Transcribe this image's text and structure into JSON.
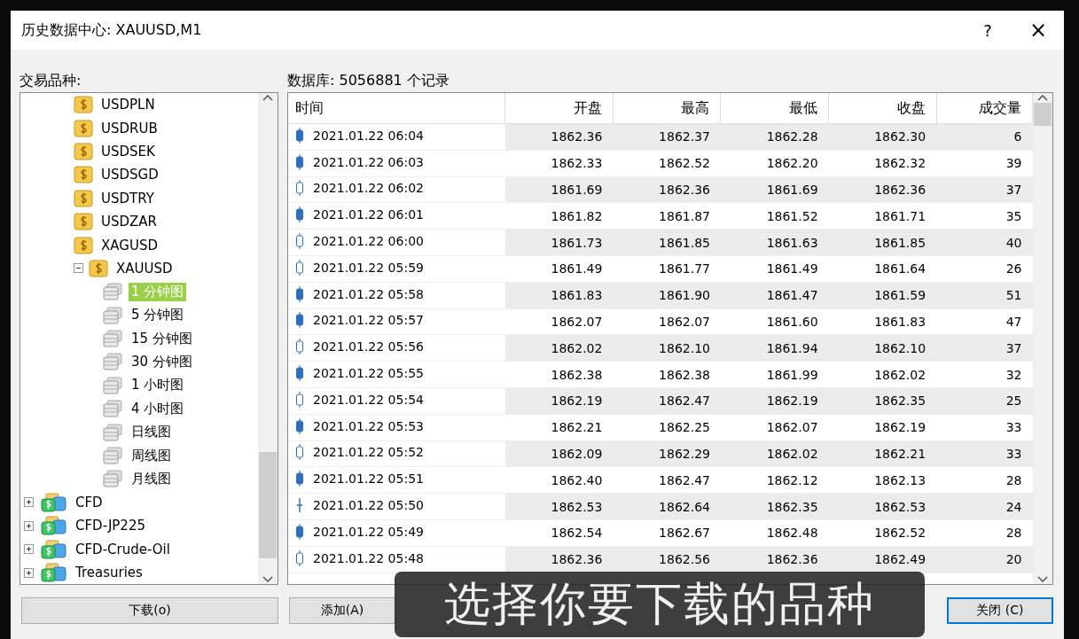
{
  "window": {
    "title": "历史数据中心: XAUUSD,M1",
    "help": "?",
    "close": "×"
  },
  "symbols": {
    "label": "交易品种:",
    "tree": [
      {
        "label": "USDPLN",
        "kind": "symbol",
        "selected": false
      },
      {
        "label": "USDRUB",
        "kind": "symbol",
        "selected": false
      },
      {
        "label": "USDSEK",
        "kind": "symbol",
        "selected": false
      },
      {
        "label": "USDSGD",
        "kind": "symbol",
        "selected": false
      },
      {
        "label": "USDTRY",
        "kind": "symbol",
        "selected": false
      },
      {
        "label": "USDZAR",
        "kind": "symbol",
        "selected": false
      },
      {
        "label": "XAGUSD",
        "kind": "symbol",
        "selected": false
      },
      {
        "label": "XAUUSD",
        "kind": "symbol",
        "selected": false,
        "expanded": true,
        "children": [
          {
            "label": "1 分钟图",
            "kind": "period",
            "selected": true
          },
          {
            "label": "5 分钟图",
            "kind": "period",
            "selected": false
          },
          {
            "label": "15 分钟图",
            "kind": "period",
            "selected": false
          },
          {
            "label": "30 分钟图",
            "kind": "period",
            "selected": false
          },
          {
            "label": "1 小时图",
            "kind": "period",
            "selected": false
          },
          {
            "label": "4 小时图",
            "kind": "period",
            "selected": false
          },
          {
            "label": "日线图",
            "kind": "period",
            "selected": false
          },
          {
            "label": "周线图",
            "kind": "period",
            "selected": false
          },
          {
            "label": "月线图",
            "kind": "period",
            "selected": false
          }
        ]
      },
      {
        "label": "CFD",
        "kind": "group",
        "selected": false,
        "expanded": false
      },
      {
        "label": "CFD-JP225",
        "kind": "group",
        "selected": false,
        "expanded": false
      },
      {
        "label": "CFD-Crude-Oil",
        "kind": "group",
        "selected": false,
        "expanded": false
      },
      {
        "label": "Treasuries",
        "kind": "group",
        "selected": false,
        "expanded": false
      }
    ]
  },
  "database": {
    "label": "数据库: 5056881 个记录",
    "columns": [
      "时间",
      "开盘",
      "最高",
      "最低",
      "收盘",
      "成交量"
    ],
    "rows": [
      {
        "kind": "bear",
        "cells": [
          "2021.01.22 06:04",
          "1862.36",
          "1862.37",
          "1862.28",
          "1862.30",
          "6"
        ]
      },
      {
        "kind": "bear",
        "cells": [
          "2021.01.22 06:03",
          "1862.33",
          "1862.52",
          "1862.20",
          "1862.32",
          "39"
        ]
      },
      {
        "kind": "bull",
        "cells": [
          "2021.01.22 06:02",
          "1861.69",
          "1862.36",
          "1861.69",
          "1862.36",
          "37"
        ]
      },
      {
        "kind": "bear",
        "cells": [
          "2021.01.22 06:01",
          "1861.82",
          "1861.87",
          "1861.52",
          "1861.71",
          "35"
        ]
      },
      {
        "kind": "bull",
        "cells": [
          "2021.01.22 06:00",
          "1861.73",
          "1861.85",
          "1861.63",
          "1861.85",
          "40"
        ]
      },
      {
        "kind": "bull",
        "cells": [
          "2021.01.22 05:59",
          "1861.49",
          "1861.77",
          "1861.49",
          "1861.64",
          "26"
        ]
      },
      {
        "kind": "bear",
        "cells": [
          "2021.01.22 05:58",
          "1861.83",
          "1861.90",
          "1861.47",
          "1861.59",
          "51"
        ]
      },
      {
        "kind": "bear",
        "cells": [
          "2021.01.22 05:57",
          "1862.07",
          "1862.07",
          "1861.60",
          "1861.83",
          "47"
        ]
      },
      {
        "kind": "bull",
        "cells": [
          "2021.01.22 05:56",
          "1862.02",
          "1862.10",
          "1861.94",
          "1862.10",
          "37"
        ]
      },
      {
        "kind": "bear",
        "cells": [
          "2021.01.22 05:55",
          "1862.38",
          "1862.38",
          "1861.99",
          "1862.02",
          "32"
        ]
      },
      {
        "kind": "bull",
        "cells": [
          "2021.01.22 05:54",
          "1862.19",
          "1862.47",
          "1862.19",
          "1862.35",
          "25"
        ]
      },
      {
        "kind": "bear",
        "cells": [
          "2021.01.22 05:53",
          "1862.21",
          "1862.25",
          "1862.07",
          "1862.19",
          "33"
        ]
      },
      {
        "kind": "bull",
        "cells": [
          "2021.01.22 05:52",
          "1862.09",
          "1862.29",
          "1862.02",
          "1862.21",
          "33"
        ]
      },
      {
        "kind": "bear",
        "cells": [
          "2021.01.22 05:51",
          "1862.40",
          "1862.47",
          "1862.12",
          "1862.13",
          "28"
        ]
      },
      {
        "kind": "doji",
        "cells": [
          "2021.01.22 05:50",
          "1862.53",
          "1862.64",
          "1862.35",
          "1862.53",
          "24"
        ]
      },
      {
        "kind": "bear",
        "cells": [
          "2021.01.22 05:49",
          "1862.54",
          "1862.67",
          "1862.48",
          "1862.52",
          "28"
        ]
      },
      {
        "kind": "bull",
        "cells": [
          "2021.01.22 05:48",
          "1862.36",
          "1862.56",
          "1862.36",
          "1862.49",
          "20"
        ]
      }
    ]
  },
  "buttons": [
    {
      "label": "下载(o)",
      "default": false
    },
    {
      "label": "添加(A)",
      "default": false
    },
    {
      "label": "关闭 (C)",
      "default": true
    }
  ],
  "subtitle": "选择你要下载的品种"
}
